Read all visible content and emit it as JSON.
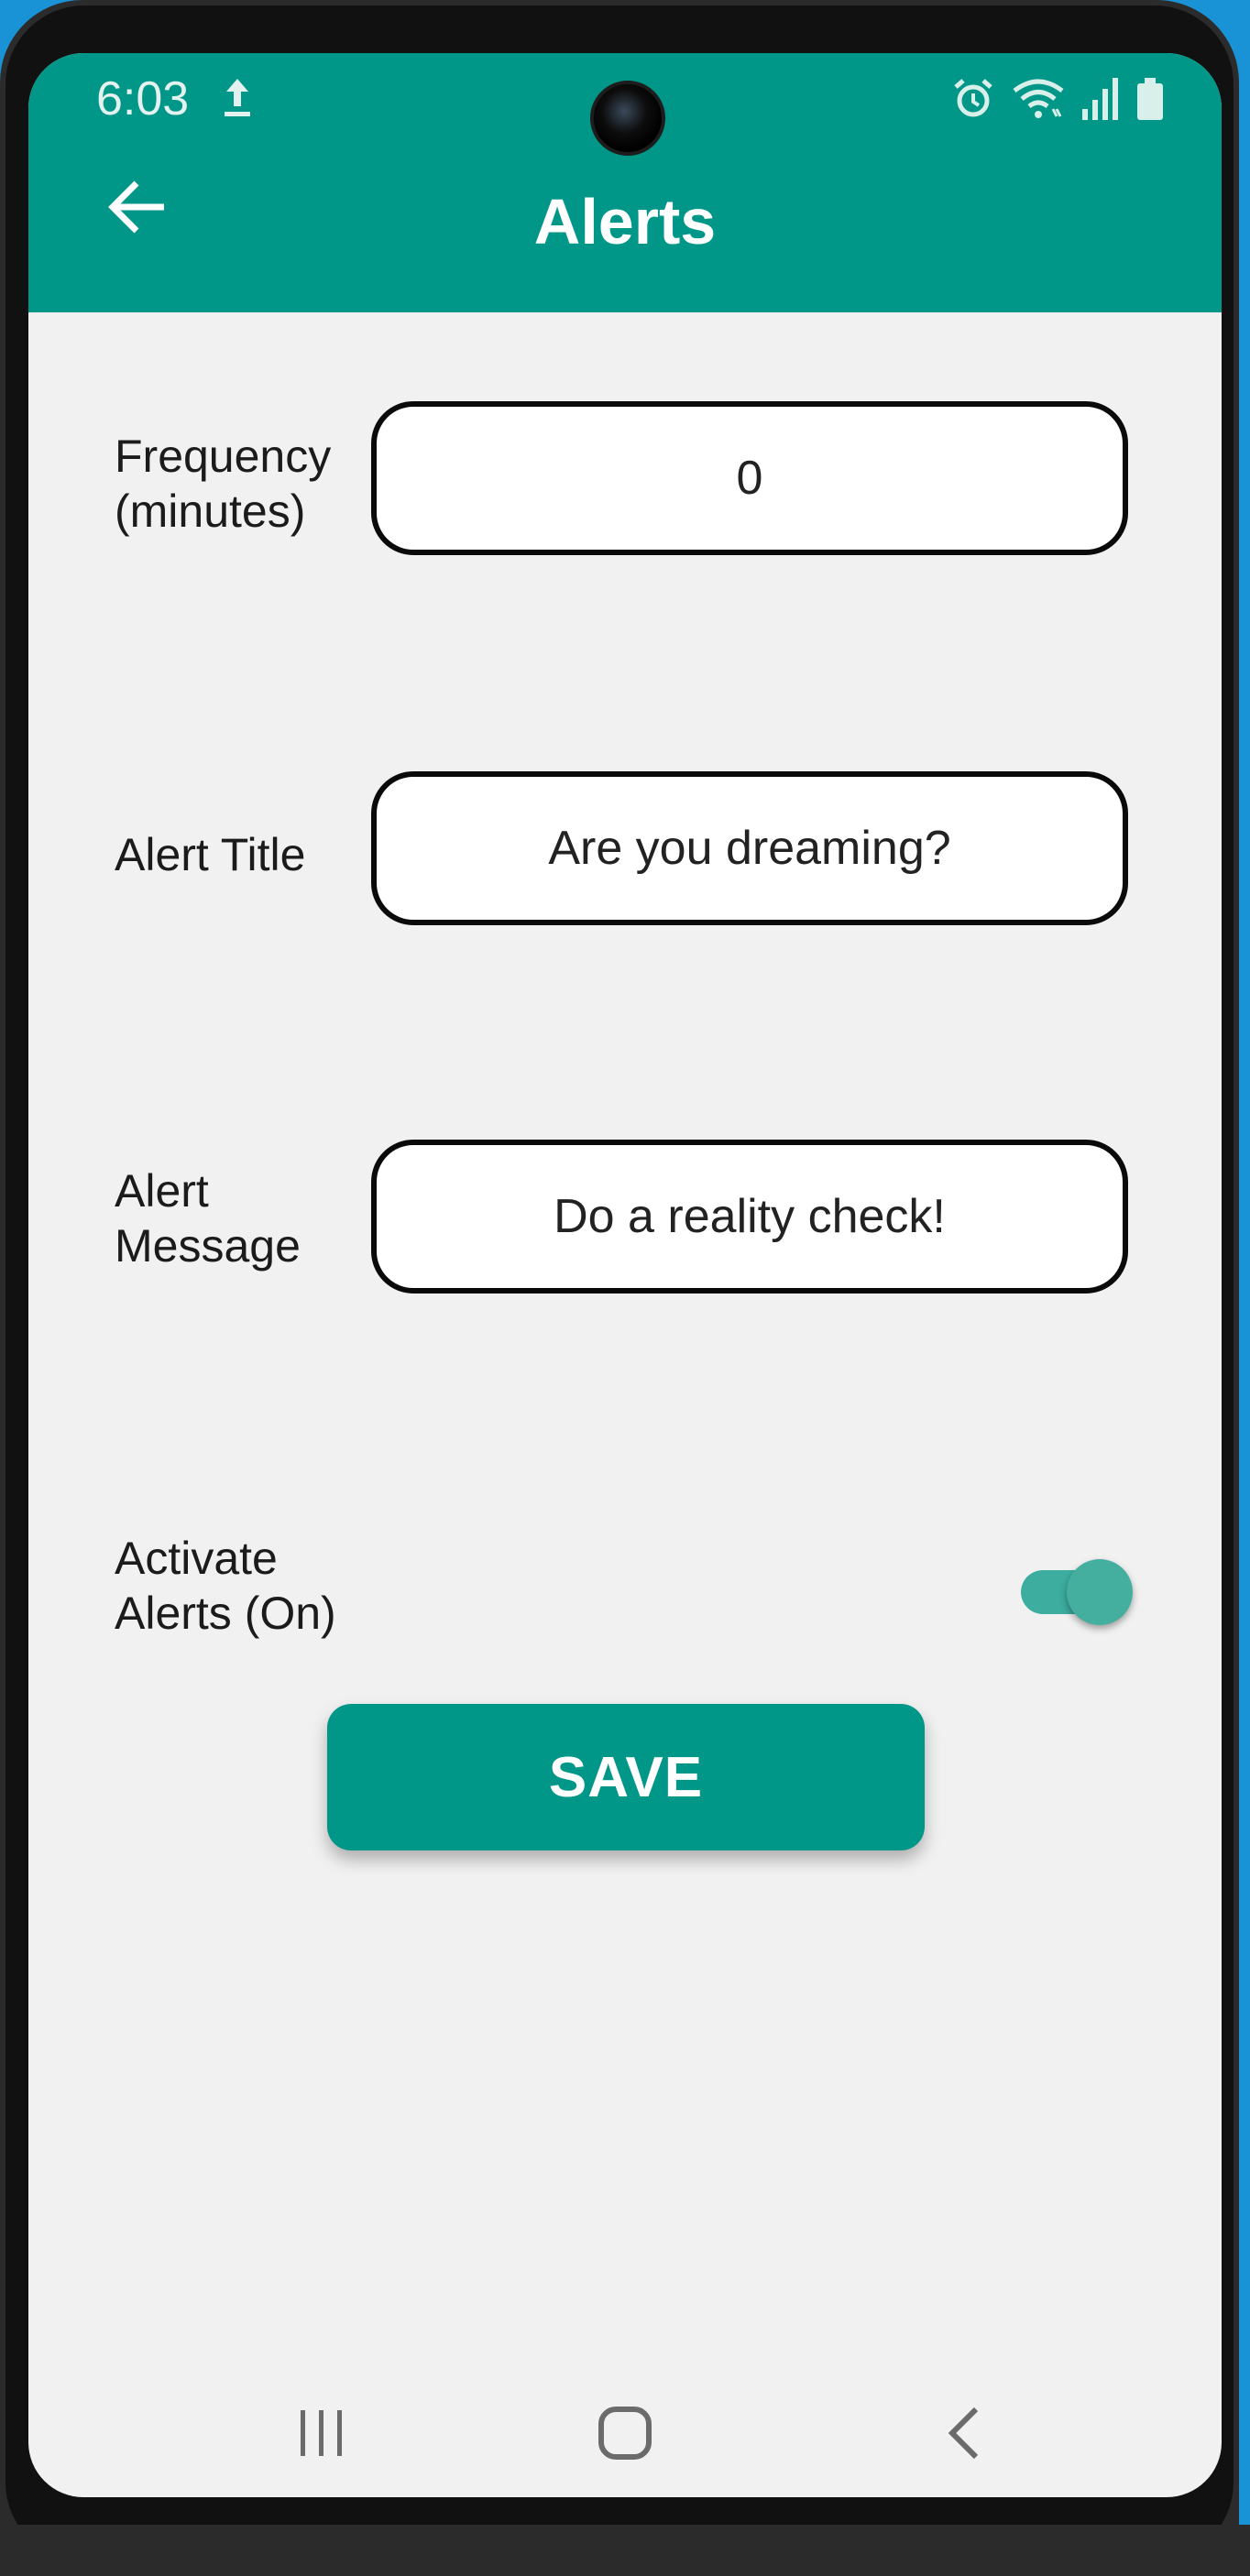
{
  "status_bar": {
    "time": "6:03",
    "icons": [
      "upload-icon",
      "alarm-icon",
      "wifi-icon",
      "signal-icon",
      "battery-icon"
    ]
  },
  "app_bar": {
    "title": "Alerts",
    "back_icon": "arrow-left-icon",
    "color": "#009688"
  },
  "form": {
    "frequency": {
      "label": "Frequency\n(minutes)",
      "value": "0"
    },
    "alert_title": {
      "label": "Alert Title",
      "value": "Are you dreaming?"
    },
    "alert_message": {
      "label": "Alert\nMessage",
      "value": "Do a reality check!"
    },
    "activate": {
      "label": "Activate\nAlerts (On)",
      "on": true
    }
  },
  "save_button": {
    "label": "SAVE"
  },
  "nav_bar": {
    "buttons": [
      "recent-apps-icon",
      "home-icon",
      "back-icon"
    ]
  }
}
